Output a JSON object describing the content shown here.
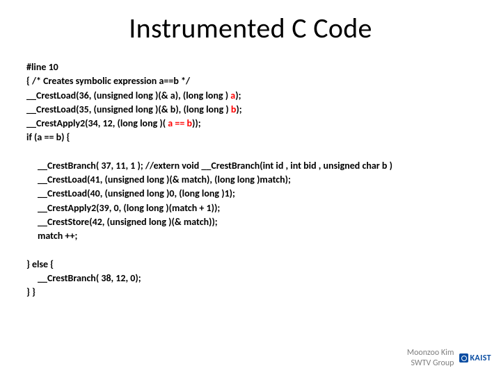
{
  "title": "Instrumented C Code",
  "code": {
    "block1": {
      "l1": "#line 10",
      "l2": " { /* Creates symbolic expression a==b */",
      "l3a": "  __CrestLoad(36, (unsigned long )(& a), (long long )  ",
      "l3r": "a",
      "l3c": ");",
      "l4a": "  __CrestLoad(35, (unsigned long )(& b), (long long )  ",
      "l4r": "b",
      "l4c": ");",
      "l5a": "  __CrestApply2(34, 12, (long long )( ",
      "l5r": "a == b",
      "l5c": "));",
      "l6": "  if (a == b) {"
    },
    "block2": {
      "l1": "__CrestBranch( 37, 11, 1 );  //extern void __CrestBranch(int id , int bid , unsigned char b )",
      "l2": "__CrestLoad(41, (unsigned long )(& match), (long long )match);",
      "l3": "__CrestLoad(40, (unsigned long )0, (long long )1);",
      "l4": "__CrestApply2(39, 0, (long long )(match + 1));",
      "l5": "__CrestStore(42, (unsigned long )(& match));",
      "l6": "match ++;"
    },
    "block3": {
      "l1": "} else {",
      "l2": "__CrestBranch( 38, 12, 0);",
      "l3": "} }"
    }
  },
  "footer": {
    "line1": "Moonzoo Kim",
    "line2": "SWTV Group",
    "logo_text": "KAIST"
  }
}
